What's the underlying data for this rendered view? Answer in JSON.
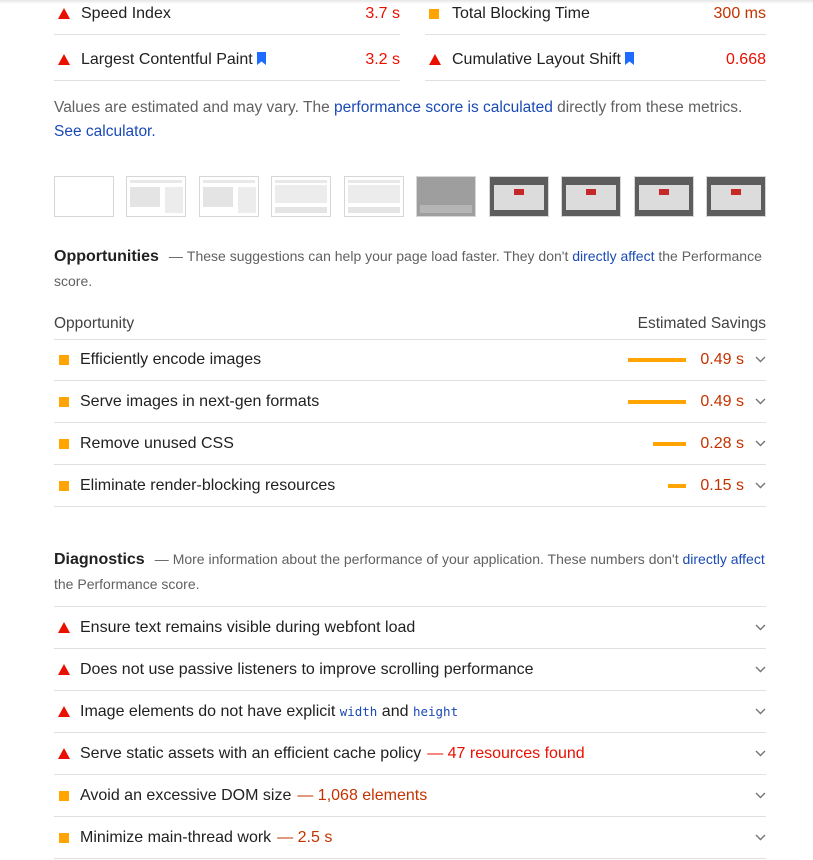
{
  "metrics": [
    {
      "label": "Speed Index",
      "value": "3.7 s",
      "status": "fail"
    },
    {
      "label": "Total Blocking Time",
      "value": "300 ms",
      "status": "average"
    },
    {
      "label": "Largest Contentful Paint",
      "value": "3.2 s",
      "status": "fail"
    },
    {
      "label": "Cumulative Layout Shift",
      "value": "0.668",
      "status": "fail"
    }
  ],
  "note": {
    "prefix": "Values are estimated and may vary. The ",
    "link1": "performance score is calculated",
    "middle": " directly from these metrics. ",
    "link2": "See calculator."
  },
  "opportunities": {
    "title": "Opportunities",
    "desc_prefix": "These suggestions can help your page load faster. They don't ",
    "desc_link": "directly affect",
    "desc_suffix": " the Performance score.",
    "col_left": "Opportunity",
    "col_right": "Estimated Savings",
    "items": [
      {
        "label": "Efficiently encode images",
        "saving": "0.49 s",
        "bar_fraction": 1.0
      },
      {
        "label": "Serve images in next-gen formats",
        "saving": "0.49 s",
        "bar_fraction": 1.0
      },
      {
        "label": "Remove unused CSS",
        "saving": "0.28 s",
        "bar_fraction": 0.57
      },
      {
        "label": "Eliminate render-blocking resources",
        "saving": "0.15 s",
        "bar_fraction": 0.31
      }
    ]
  },
  "diagnostics": {
    "title": "Diagnostics",
    "desc_prefix": "More information about the performance of your application. These numbers don't ",
    "desc_link": "directly affect",
    "desc_suffix": " the Performance score.",
    "items": [
      {
        "label": "Ensure text remains visible during webfont load",
        "status": "fail"
      },
      {
        "label": "Does not use passive listeners to improve scrolling performance",
        "status": "fail"
      },
      {
        "label_a": "Image elements do not have explicit ",
        "code1": "width",
        "label_b": " and ",
        "code2": "height",
        "status": "fail"
      },
      {
        "label": "Serve static assets with an efficient cache policy",
        "extra": "47 resources found",
        "status": "fail"
      },
      {
        "label": "Avoid an excessive DOM size",
        "extra": "1,068 elements",
        "status": "average"
      },
      {
        "label": "Minimize main-thread work",
        "extra": "2.5 s",
        "status": "average"
      }
    ]
  },
  "colors": {
    "fail": "#eb0f00",
    "average": "#ffa400",
    "link": "#1a4ab5"
  }
}
